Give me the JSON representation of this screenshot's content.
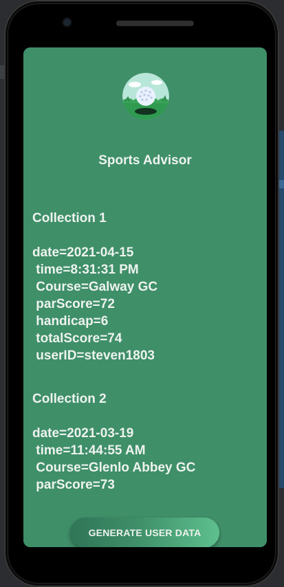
{
  "app": {
    "title": "Sports Advisor",
    "logo_icon": "golf-ball-on-tee-icon"
  },
  "records": [
    {
      "title": "Collection 1",
      "lines": [
        "date=2021-04-15",
        " time=8:31:31 PM",
        " Course=Galway GC",
        " parScore=72",
        " handicap=6",
        " totalScore=74",
        " userID=steven1803"
      ]
    },
    {
      "title": "Collection 2",
      "lines": [
        "date=2021-03-19",
        " time=11:44:55 AM",
        " Course=Glenlo Abbey GC",
        " parScore=73"
      ]
    }
  ],
  "actions": {
    "generate_label": "GENERATE USER DATA"
  },
  "colors": {
    "screen_bg": "#3f8f69",
    "text": "#eef3ee",
    "button_accent": "#5ec08e"
  }
}
